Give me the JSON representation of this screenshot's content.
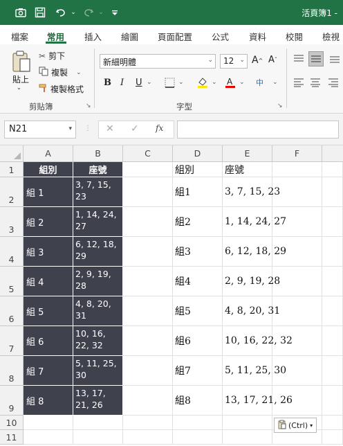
{
  "titlebar": {
    "title": "活頁簿1 -",
    "accent": "#217346"
  },
  "tabs": [
    {
      "label": "檔案"
    },
    {
      "label": "常用"
    },
    {
      "label": "插入"
    },
    {
      "label": "繪圖"
    },
    {
      "label": "頁面配置"
    },
    {
      "label": "公式"
    },
    {
      "label": "資料"
    },
    {
      "label": "校閱"
    },
    {
      "label": "檢視"
    }
  ],
  "ribbon": {
    "paste": "貼上",
    "cut": "剪下",
    "copy": "複製",
    "format_painter": "複製格式",
    "clipboard_group": "剪貼簿",
    "font_name": "新細明體",
    "font_size": "12",
    "font_group": "字型"
  },
  "formula": {
    "name_box": "N21",
    "fx": "fx"
  },
  "columns": [
    "A",
    "B",
    "C",
    "D",
    "E",
    "F"
  ],
  "rows": [
    "1",
    "2",
    "3",
    "4",
    "5",
    "6",
    "7",
    "8",
    "9",
    "10",
    "11"
  ],
  "table_left": {
    "headers": [
      "組別",
      "座號"
    ],
    "rows": [
      {
        "group": "組 1",
        "seats": "3, 7, 15, 23"
      },
      {
        "group": "組 2",
        "seats": "1, 14, 24, 27"
      },
      {
        "group": "組 3",
        "seats": "6, 12, 18, 29"
      },
      {
        "group": "組 4",
        "seats": "2, 9, 19, 28"
      },
      {
        "group": "組 5",
        "seats": "4, 8, 20, 31"
      },
      {
        "group": "組 6",
        "seats": "10, 16, 22, 32"
      },
      {
        "group": "組 7",
        "seats": "5, 11, 25, 30"
      },
      {
        "group": "組 8",
        "seats": "13, 17, 21, 26"
      }
    ]
  },
  "table_right": {
    "headers": [
      "組別",
      "座號"
    ],
    "rows": [
      {
        "group": "組1",
        "seats": "3, 7, 15, 23"
      },
      {
        "group": "組2",
        "seats": "1, 14, 24, 27"
      },
      {
        "group": "組3",
        "seats": "6, 12, 18, 29"
      },
      {
        "group": "組4",
        "seats": "2, 9, 19, 28"
      },
      {
        "group": "組5",
        "seats": "4, 8, 20, 31"
      },
      {
        "group": "組6",
        "seats": "10, 16, 22, 32"
      },
      {
        "group": "組7",
        "seats": "5, 11, 25, 30"
      },
      {
        "group": "組8",
        "seats": "13, 17, 21, 26"
      }
    ]
  },
  "paste_options": "(Ctrl)"
}
